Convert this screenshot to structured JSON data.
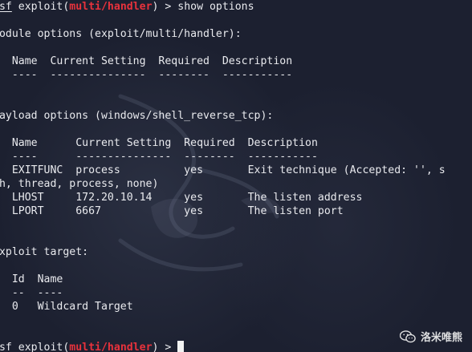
{
  "terminal": {
    "lines": [
      {
        "type": "prompt",
        "prefix": "msf",
        "pre": " exploit(",
        "module": "multi/handler",
        "post": ") > show options"
      },
      {
        "type": "text",
        "text": ""
      },
      {
        "type": "text",
        "text": "Module options (exploit/multi/handler):"
      },
      {
        "type": "text",
        "text": ""
      },
      {
        "type": "text",
        "text": "   Name  Current Setting  Required  Description"
      },
      {
        "type": "text",
        "text": "   ----  ---------------  --------  -----------"
      },
      {
        "type": "text",
        "text": ""
      },
      {
        "type": "text",
        "text": ""
      },
      {
        "type": "text",
        "text": "Payload options (windows/shell_reverse_tcp):"
      },
      {
        "type": "text",
        "text": ""
      },
      {
        "type": "text",
        "text": "   Name      Current Setting  Required  Description"
      },
      {
        "type": "text",
        "text": "   ----      ---------------  --------  -----------"
      },
      {
        "type": "text",
        "text": "   EXITFUNC  process          yes       Exit technique (Accepted: '', s"
      },
      {
        "type": "text",
        "text": "eh, thread, process, none)"
      },
      {
        "type": "text",
        "text": "   LHOST     172.20.10.14     yes       The listen address"
      },
      {
        "type": "text",
        "text": "   LPORT     6667             yes       The listen port"
      },
      {
        "type": "text",
        "text": ""
      },
      {
        "type": "text",
        "text": ""
      },
      {
        "type": "text",
        "text": "Exploit target:"
      },
      {
        "type": "text",
        "text": ""
      },
      {
        "type": "text",
        "text": "   Id  Name"
      },
      {
        "type": "text",
        "text": "   --  ----"
      },
      {
        "type": "text",
        "text": "   0   Wildcard Target"
      },
      {
        "type": "text",
        "text": ""
      },
      {
        "type": "text",
        "text": ""
      },
      {
        "type": "prompt_cursor",
        "prefix": "msf",
        "pre": " exploit(",
        "module": "multi/handler",
        "post": ") > "
      }
    ]
  },
  "watermark": {
    "text": "洛米唯熊",
    "icon": "wechat-icon"
  },
  "colors": {
    "background": "#1c2030",
    "text": "#e9eaee",
    "module_highlight": "#e8323c"
  }
}
